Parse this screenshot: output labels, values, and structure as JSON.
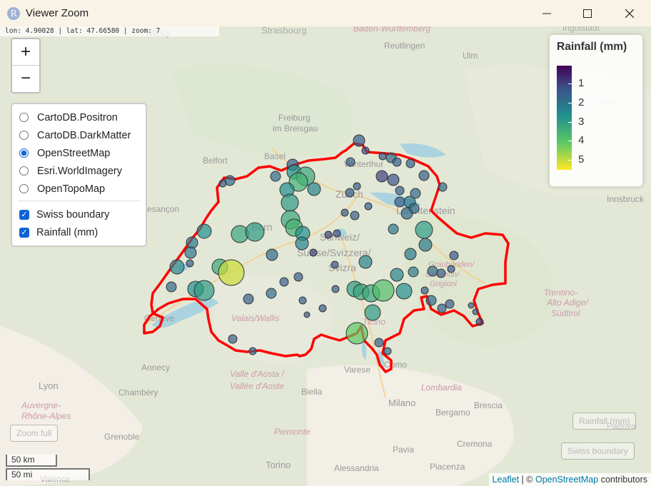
{
  "window": {
    "title": "Viewer Zoom",
    "icon": "R"
  },
  "status": {
    "coords": "lon: 4.90028 | lat: 47.66580 | zoom: 7"
  },
  "zoom": {
    "in": "+",
    "out": "−"
  },
  "layers": {
    "basemaps": [
      {
        "label": "CartoDB.Positron",
        "selected": false
      },
      {
        "label": "CartoDB.DarkMatter",
        "selected": false
      },
      {
        "label": "OpenStreetMap",
        "selected": true
      },
      {
        "label": "Esri.WorldImagery",
        "selected": false
      },
      {
        "label": "OpenTopoMap",
        "selected": false
      }
    ],
    "overlays": [
      {
        "label": "Swiss boundary",
        "checked": true
      },
      {
        "label": "Rainfall (mm)",
        "checked": true
      }
    ]
  },
  "legend": {
    "title": "Rainfall (mm)",
    "ticks": [
      "1",
      "2",
      "3",
      "4",
      "5"
    ]
  },
  "buttons": {
    "zoom_full": "Zoom full",
    "rainfall": "Rainfall (mm)",
    "swiss": "Swiss boundary"
  },
  "scale": {
    "km": "50 km",
    "mi": "50 mi"
  },
  "attribution": {
    "leaflet": "Leaflet",
    "sep": " | © ",
    "osm": "OpenStreetMap",
    "contrib": " contributors"
  },
  "places": [
    {
      "name": "Nancy"
    },
    {
      "name": "Strasbourg"
    },
    {
      "name": "Baden-Württemberg"
    },
    {
      "name": "Reutlingen"
    },
    {
      "name": "Ulm"
    },
    {
      "name": "Ingolstadt"
    },
    {
      "name": "Freiburg"
    },
    {
      "name": "im Breisgau"
    },
    {
      "name": "München"
    },
    {
      "name": "Belfort"
    },
    {
      "name": "Basel"
    },
    {
      "name": "Winterthur"
    },
    {
      "name": "Zürich"
    },
    {
      "name": "Liechtenstein"
    },
    {
      "name": "Innsbruck"
    },
    {
      "name": "Besançon"
    },
    {
      "name": "Bern"
    },
    {
      "name": "Schweiz/"
    },
    {
      "name": "Suisse/Svizzera/"
    },
    {
      "name": "Svizra"
    },
    {
      "name": "Graubünden/"
    },
    {
      "name": "Grischun/"
    },
    {
      "name": "Grigioni"
    },
    {
      "name": "Genève"
    },
    {
      "name": "Valais/Wallis"
    },
    {
      "name": "Ticino"
    },
    {
      "name": "Trentino-"
    },
    {
      "name": "Alto Adige/"
    },
    {
      "name": "Südtirol"
    },
    {
      "name": "Annecy"
    },
    {
      "name": "Lyon"
    },
    {
      "name": "Chambéry"
    },
    {
      "name": "Valle d'Aosta /"
    },
    {
      "name": "Vallée d'Aoste"
    },
    {
      "name": "Biella"
    },
    {
      "name": "Varese"
    },
    {
      "name": "Como"
    },
    {
      "name": "Lombardia"
    },
    {
      "name": "Milano"
    },
    {
      "name": "Bergamo"
    },
    {
      "name": "Brescia"
    },
    {
      "name": "Auvergne-"
    },
    {
      "name": "Rhône-Alpes"
    },
    {
      "name": "Grenoble"
    },
    {
      "name": "Piemonte"
    },
    {
      "name": "Torino"
    },
    {
      "name": "Alessandria"
    },
    {
      "name": "Pavia"
    },
    {
      "name": "Cremona"
    },
    {
      "name": "Piacenza"
    },
    {
      "name": "Padova"
    },
    {
      "name": "Valence"
    }
  ],
  "colors": {
    "boundary": "#ff0000",
    "point_stroke": "#333333"
  }
}
